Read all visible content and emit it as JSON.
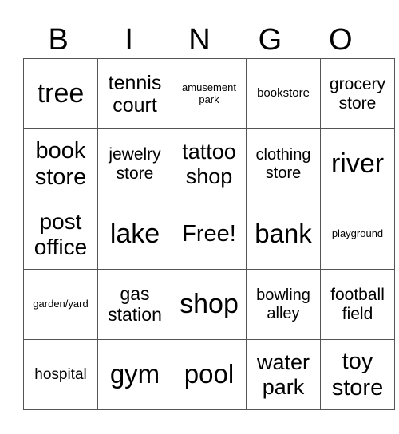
{
  "header": [
    "B",
    "I",
    "N",
    "G",
    "O"
  ],
  "rows": [
    [
      {
        "t": "tree",
        "s": 34
      },
      {
        "t": "tennis court",
        "s": 25
      },
      {
        "t": "amusement park",
        "s": 13
      },
      {
        "t": "bookstore",
        "s": 15
      },
      {
        "t": "grocery store",
        "s": 21
      }
    ],
    [
      {
        "t": "book store",
        "s": 29
      },
      {
        "t": "jewelry store",
        "s": 21
      },
      {
        "t": "tattoo shop",
        "s": 27
      },
      {
        "t": "clothing store",
        "s": 20
      },
      {
        "t": "river",
        "s": 34
      }
    ],
    [
      {
        "t": "post office",
        "s": 28
      },
      {
        "t": "lake",
        "s": 34
      },
      {
        "t": "Free!",
        "s": 29
      },
      {
        "t": "bank",
        "s": 33
      },
      {
        "t": "playground",
        "s": 13
      }
    ],
    [
      {
        "t": "garden/yard",
        "s": 13
      },
      {
        "t": "gas station",
        "s": 23
      },
      {
        "t": "shop",
        "s": 34
      },
      {
        "t": "bowling alley",
        "s": 20
      },
      {
        "t": "football field",
        "s": 21
      }
    ],
    [
      {
        "t": "hospital",
        "s": 19
      },
      {
        "t": "gym",
        "s": 33
      },
      {
        "t": "pool",
        "s": 33
      },
      {
        "t": "water park",
        "s": 27
      },
      {
        "t": "toy store",
        "s": 29
      }
    ]
  ]
}
